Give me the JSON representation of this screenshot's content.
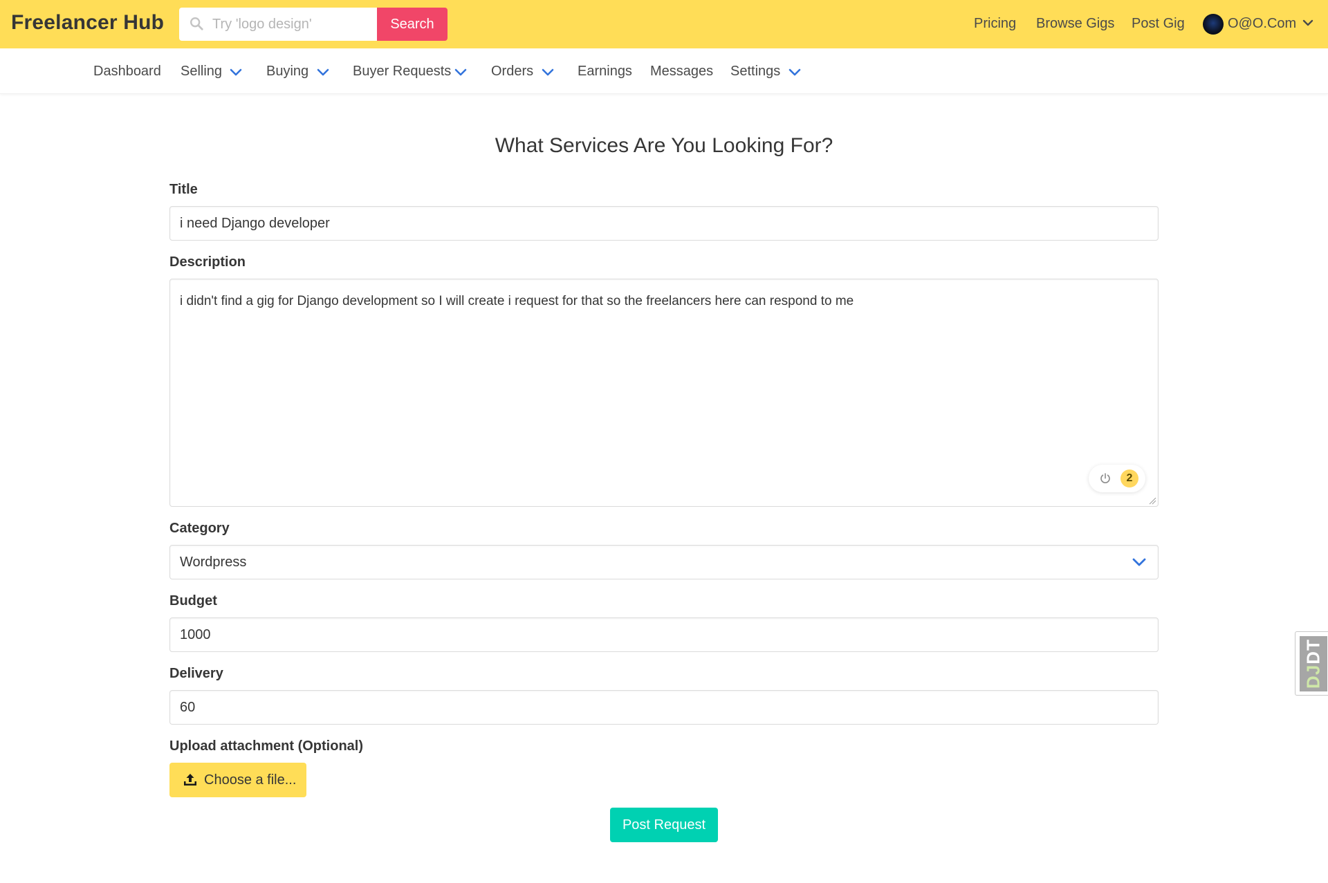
{
  "app": {
    "brand": "Freelancer Hub"
  },
  "search": {
    "placeholder": "Try 'logo design'",
    "button_label": "Search"
  },
  "top_nav": {
    "links": [
      "Pricing",
      "Browse Gigs",
      "Post Gig"
    ],
    "user_label": "O@O.Com"
  },
  "sub_nav": {
    "items": [
      "Dashboard",
      "Selling",
      "Buying",
      "Buyer Requests",
      "Orders",
      "Earnings",
      "Messages",
      "Settings"
    ]
  },
  "form": {
    "heading": "What Services Are You Looking For?",
    "title_label": "Title",
    "title_value": "i need Django developer",
    "description_label": "Description",
    "description_value": "i didn't find a gig for Django development so I will create i request for that so the freelancers here can respond to me",
    "grammar_issue_count": "2",
    "category_label": "Category",
    "category_value": "Wordpress",
    "budget_label": "Budget",
    "budget_value": "1000",
    "delivery_label": "Delivery",
    "delivery_value": "60",
    "attachment_label": "Upload attachment (Optional)",
    "choose_file_label": "Choose a file...",
    "submit_label": "Post Request"
  },
  "debug_toolbar": {
    "handle_prefix": "DJ",
    "handle_suffix": "DT"
  },
  "colors": {
    "navbar": "#ffdd57",
    "search_button": "#f14668",
    "primary_button": "#00d1b2",
    "file_button": "#ffdd57",
    "chevron": "#3273dc"
  },
  "icons": [
    "search-icon",
    "chevron-down-icon",
    "power-icon",
    "upload-icon",
    "avatar"
  ]
}
